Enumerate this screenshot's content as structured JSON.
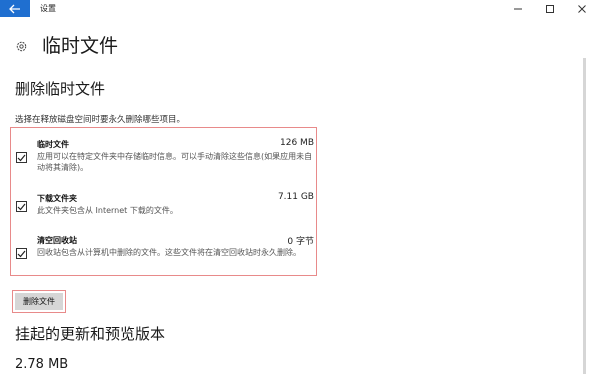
{
  "window": {
    "title": "设置",
    "minimize_symbol": "–",
    "maximize_symbol": "□",
    "close_symbol": "✕"
  },
  "header": {
    "icon": "gear-icon",
    "title": "临时文件"
  },
  "delete_section": {
    "title": "删除临时文件",
    "instruction": "选择在释放磁盘空间时要永久删除哪些项目。",
    "items": [
      {
        "name": "临时文件",
        "size": "126 MB",
        "description": "应用可以在特定文件夹中存储临时信息。可以手动清除这些信息(如果应用未自动将其清除)。",
        "checked": true
      },
      {
        "name": "下载文件夹",
        "size": "7.11 GB",
        "description": "此文件夹包含从 Internet 下载的文件。",
        "checked": true
      },
      {
        "name": "清空回收站",
        "size": "0 字节",
        "description": "回收站包含从计算机中删除的文件。这些文件将在清空回收站时永久删除。",
        "checked": true
      }
    ],
    "delete_button_label": "删除文件"
  },
  "updates_section": {
    "title": "挂起的更新和预览版本",
    "size": "2.78 MB"
  },
  "colors": {
    "accent": "#1f6fd0",
    "highlight_border": "#e88a8a",
    "button_bg": "#d6d6d6"
  }
}
